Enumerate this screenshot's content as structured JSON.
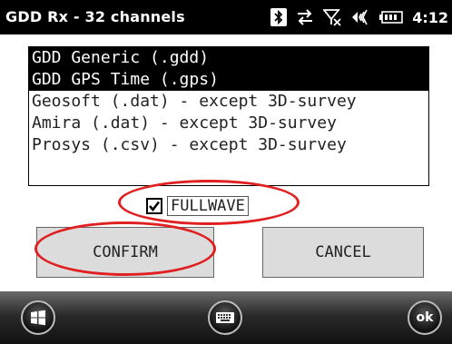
{
  "window": {
    "title": "GDD Rx - 32 channels",
    "clock": "4:12"
  },
  "status_icons": [
    "bluetooth-icon",
    "sync-arrows-icon",
    "no-signal-icon",
    "volume-icon",
    "battery-icon"
  ],
  "formats": {
    "items": [
      {
        "label": "GDD Generic (.gdd)",
        "selected": true
      },
      {
        "label": "GDD GPS Time (.gps)",
        "selected": true
      },
      {
        "label": "Geosoft (.dat) - except 3D-survey",
        "selected": false
      },
      {
        "label": "Amira (.dat) - except 3D-survey",
        "selected": false
      },
      {
        "label": "Prosys (.csv) - except 3D-survey",
        "selected": false
      }
    ]
  },
  "fullwave": {
    "label": "FULLWAVE",
    "checked": true
  },
  "buttons": {
    "confirm": "CONFIRM",
    "cancel": "CANCEL"
  },
  "softkeys": {
    "ok": "ok"
  },
  "annotation_color": "#e02020"
}
